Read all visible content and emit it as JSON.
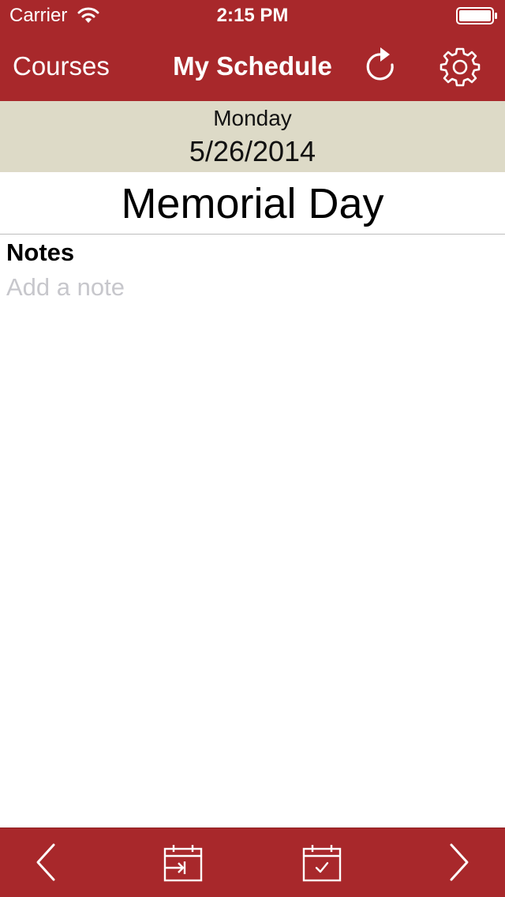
{
  "status_bar": {
    "carrier": "Carrier",
    "time": "2:15 PM",
    "wifi_icon": "wifi-icon",
    "battery_icon": "battery-icon"
  },
  "nav_bar": {
    "left_button_label": "Courses",
    "title": "My Schedule",
    "refresh_icon": "refresh-icon",
    "settings_icon": "gear-icon"
  },
  "date_header": {
    "day": "Monday",
    "date": "5/26/2014"
  },
  "event": {
    "title": "Memorial Day"
  },
  "notes": {
    "label": "Notes",
    "value": "",
    "placeholder": "Add a note"
  },
  "toolbar": {
    "prev_icon": "chevron-left-icon",
    "jump_icon": "calendar-jump-icon",
    "today_icon": "calendar-check-icon",
    "next_icon": "chevron-right-icon"
  },
  "colors": {
    "brand_red": "#a8282b",
    "date_header_bg": "#dddac7",
    "placeholder_gray": "#c7c7cc"
  }
}
